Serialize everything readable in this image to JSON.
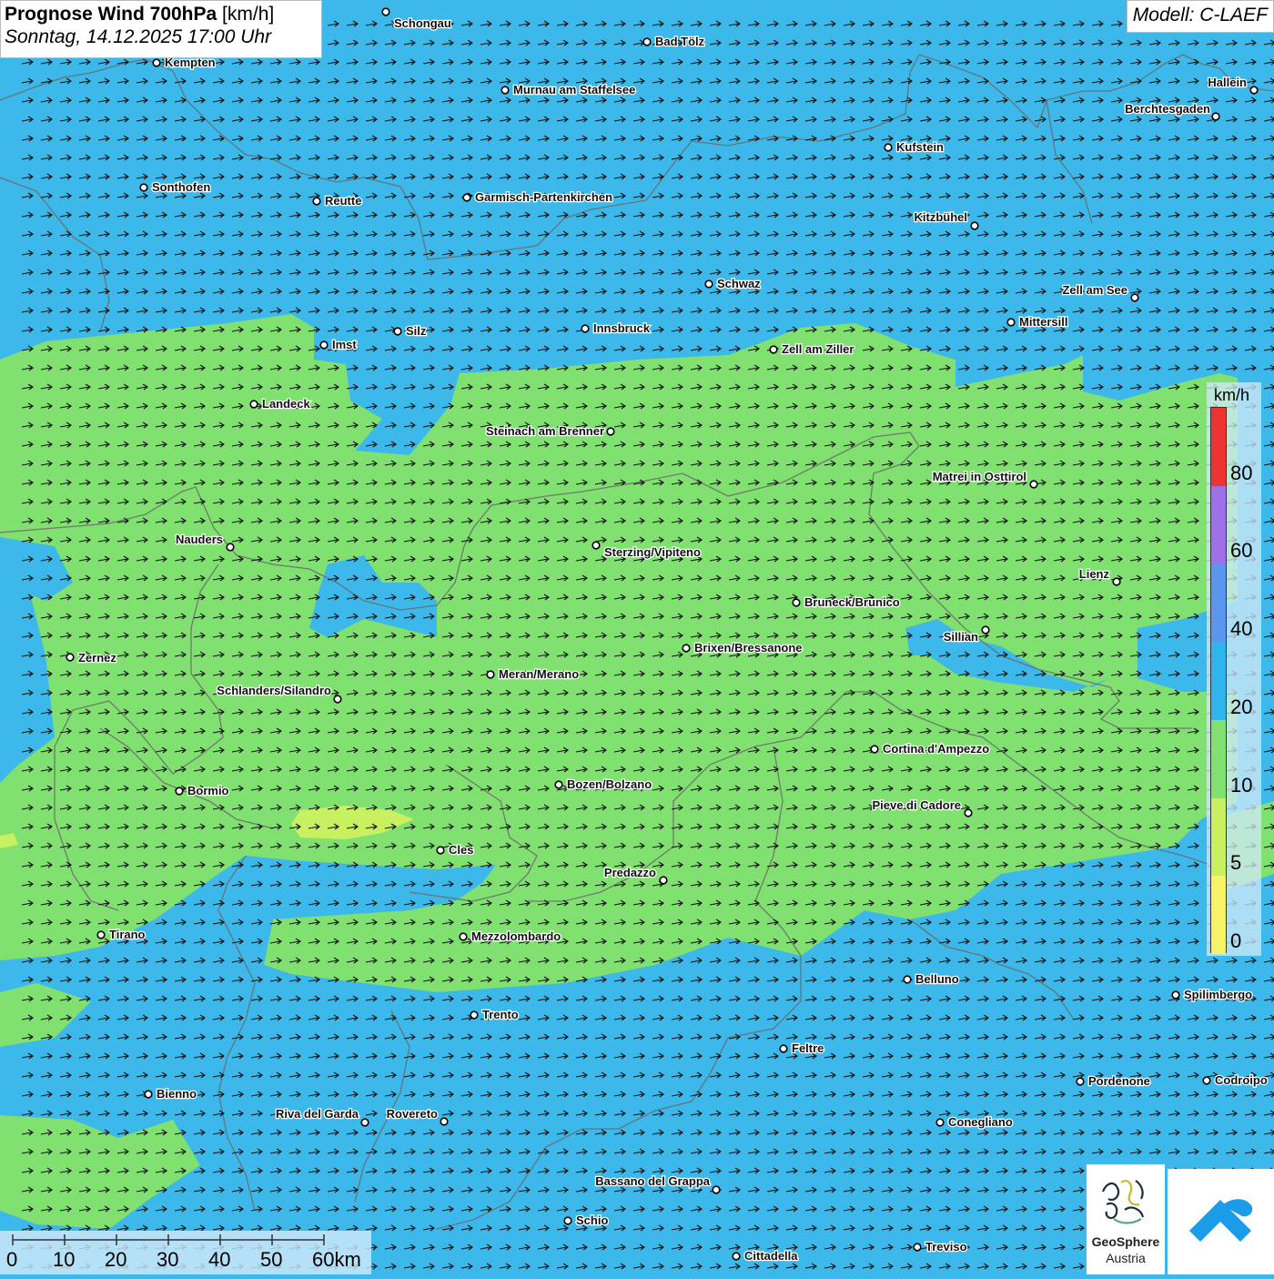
{
  "header": {
    "title_bold": "Prognose Wind 700hPa",
    "title_unit": " [km/h]",
    "subtitle": "Sonntag, 14.12.2025 17:00 Uhr"
  },
  "model": "Modell: C-LAEF",
  "legend": {
    "unit": "km/h",
    "ticks": [
      "80",
      "60",
      "40",
      "20",
      "10",
      "5",
      "0"
    ],
    "colors": [
      "#ee3333",
      "#a070e8",
      "#5a96ee",
      "#2fb4ec",
      "#80e070",
      "#c8f060",
      "#f6f466"
    ]
  },
  "scale_bar": {
    "labels": [
      "0",
      "10",
      "20",
      "30",
      "40",
      "50",
      "60km"
    ]
  },
  "wind": {
    "direction": "east",
    "speed_range_kmh": [
      10,
      20
    ]
  },
  "colors": {
    "wind_10_20": "#2fb4ec",
    "wind_5_10": "#80e070",
    "wind_0_5": "#c8f060"
  },
  "logo": {
    "name": "GeoSphere",
    "sub": "Austria"
  },
  "cities": [
    {
      "name": "Schongau"
    },
    {
      "name": "Bad Tölz"
    },
    {
      "name": "Kempten"
    },
    {
      "name": "Murnau am Staffelsee"
    },
    {
      "name": "Hallein"
    },
    {
      "name": "Berchtesgaden"
    },
    {
      "name": "Kufstein"
    },
    {
      "name": "Sonthofen"
    },
    {
      "name": "Reutte"
    },
    {
      "name": "Garmisch-Partenkirchen"
    },
    {
      "name": "Kitzbühel"
    },
    {
      "name": "Schwaz"
    },
    {
      "name": "Zell am See"
    },
    {
      "name": "Mittersill"
    },
    {
      "name": "Innsbruck"
    },
    {
      "name": "Silz"
    },
    {
      "name": "Imst"
    },
    {
      "name": "Zell am Ziller"
    },
    {
      "name": "Landeck"
    },
    {
      "name": "Steinach am Brenner"
    },
    {
      "name": "Matrei in Osttirol"
    },
    {
      "name": "Nauders"
    },
    {
      "name": "Sterzing/Vipiteno"
    },
    {
      "name": "Lienz"
    },
    {
      "name": "Bruneck/Brunico"
    },
    {
      "name": "Sillian"
    },
    {
      "name": "Brixen/Bressanone"
    },
    {
      "name": "Zernez"
    },
    {
      "name": "Meran/Merano"
    },
    {
      "name": "Schlanders/Silandro"
    },
    {
      "name": "Cortina d'Ampezzo"
    },
    {
      "name": "Bozen/Bolzano"
    },
    {
      "name": "Bormio"
    },
    {
      "name": "Pieve di Cadore"
    },
    {
      "name": "Cles"
    },
    {
      "name": "Predazzo"
    },
    {
      "name": "Tirano"
    },
    {
      "name": "Mezzolombardo"
    },
    {
      "name": "Belluno"
    },
    {
      "name": "Spilimbergo"
    },
    {
      "name": "Trento"
    },
    {
      "name": "Feltre"
    },
    {
      "name": "Pordenone"
    },
    {
      "name": "Codroipo"
    },
    {
      "name": "Bienno"
    },
    {
      "name": "Riva del Garda"
    },
    {
      "name": "Rovereto"
    },
    {
      "name": "Conegliano"
    },
    {
      "name": "Bassano del Grappa"
    },
    {
      "name": "Schio"
    },
    {
      "name": "Treviso"
    },
    {
      "name": "Cittadella"
    }
  ]
}
